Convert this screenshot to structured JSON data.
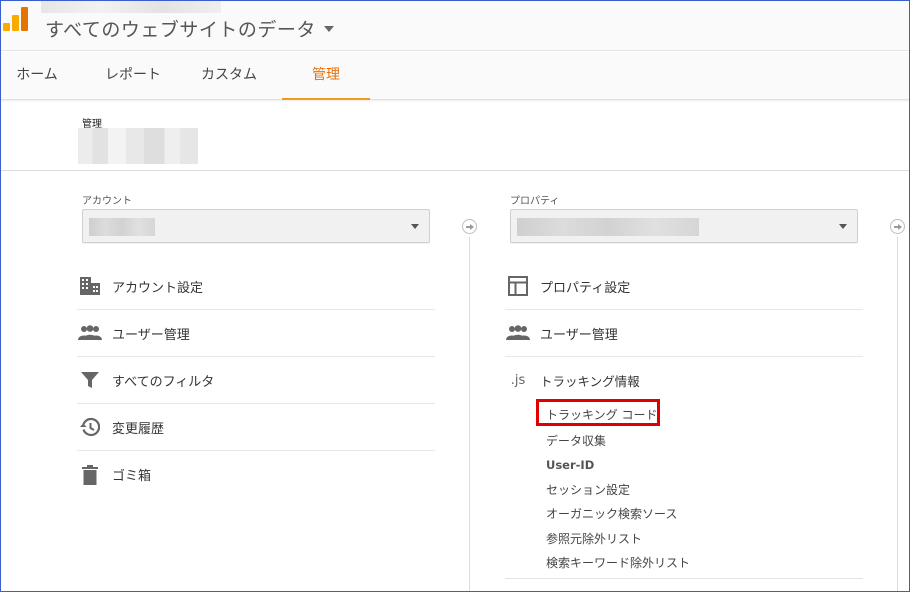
{
  "header": {
    "view_title": "すべてのウェブサイトのデータ"
  },
  "tabs": [
    {
      "label": "ホーム",
      "active": false
    },
    {
      "label": "レポート",
      "active": false
    },
    {
      "label": "カスタム",
      "active": false
    },
    {
      "label": "管理",
      "active": true
    }
  ],
  "admin": {
    "label": "管理"
  },
  "account_column": {
    "label": "アカウント",
    "items": [
      {
        "label": "アカウント設定",
        "icon": "building-icon"
      },
      {
        "label": "ユーザー管理",
        "icon": "people-icon"
      },
      {
        "label": "すべてのフィルタ",
        "icon": "filter-icon"
      },
      {
        "label": "変更履歴",
        "icon": "history-icon"
      },
      {
        "label": "ゴミ箱",
        "icon": "trash-icon"
      }
    ]
  },
  "property_column": {
    "label": "プロパティ",
    "items": [
      {
        "label": "プロパティ設定",
        "icon": "layout-icon"
      },
      {
        "label": "ユーザー管理",
        "icon": "people-icon"
      },
      {
        "label": "トラッキング情報",
        "icon": "js-icon",
        "icon_text": ".js"
      }
    ],
    "tracking_subitems": [
      {
        "label": "トラッキング コード",
        "highlighted": true
      },
      {
        "label": "データ収集"
      },
      {
        "label": "User-ID"
      },
      {
        "label": "セッション設定"
      },
      {
        "label": "オーガニック検索ソース"
      },
      {
        "label": "参照元除外リスト"
      },
      {
        "label": "検索キーワード除外リスト"
      }
    ]
  },
  "colors": {
    "accent": "#e8710a",
    "highlight": "#e00000",
    "frame": "#3a5fcd",
    "icon": "#666666"
  }
}
